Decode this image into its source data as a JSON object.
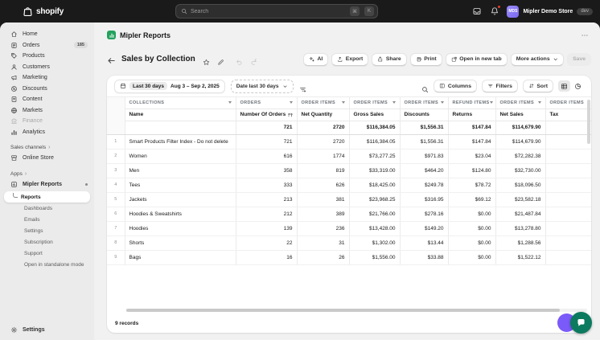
{
  "topbar": {
    "logo": "shopify",
    "search_placeholder": "Search",
    "key_1": "⌘",
    "key_2": "K",
    "store_name": "Mipler Demo Store",
    "store_env": "dev",
    "avatar_initials": "MDS"
  },
  "sidebar": {
    "items": [
      {
        "label": "Home",
        "icon": "home"
      },
      {
        "label": "Orders",
        "icon": "orders",
        "badge": "185"
      },
      {
        "label": "Products",
        "icon": "products"
      },
      {
        "label": "Customers",
        "icon": "customers"
      },
      {
        "label": "Marketing",
        "icon": "marketing"
      },
      {
        "label": "Discounts",
        "icon": "discounts"
      },
      {
        "label": "Content",
        "icon": "content"
      },
      {
        "label": "Markets",
        "icon": "markets"
      },
      {
        "label": "Finance",
        "icon": "finance",
        "disabled": true
      },
      {
        "label": "Analytics",
        "icon": "analytics"
      }
    ],
    "sales_channels_label": "Sales channels",
    "sales_channel_items": [
      {
        "label": "Online Store",
        "icon": "store"
      }
    ],
    "apps_label": "Apps",
    "app": {
      "label": "Mipler Reports",
      "icon": "app"
    },
    "app_items": [
      {
        "label": "Reports",
        "selected": true
      },
      {
        "label": "Dashboards"
      },
      {
        "label": "Emails"
      },
      {
        "label": "Settings"
      },
      {
        "label": "Subscription"
      },
      {
        "label": "Support"
      },
      {
        "label": "Open in standalone mode"
      }
    ],
    "settings_label": "Settings"
  },
  "header": {
    "app_title": "Mipler Reports",
    "page_title": "Sales by Collection"
  },
  "actions": {
    "ai": "AI",
    "export": "Export",
    "share": "Share",
    "print": "Print",
    "open_new_tab": "Open in new tab",
    "more": "More actions",
    "save": "Save"
  },
  "toolbar": {
    "range_chip": "Last 30 days",
    "range_text": "Aug 3 – Sep 2, 2025",
    "date_filter": "Date last 30 days",
    "columns": "Columns",
    "filters": "Filters",
    "sort": "Sort"
  },
  "table": {
    "group_headers": [
      "COLLECTIONS",
      "ORDERS",
      "ORDER ITEMS",
      "ORDER ITEMS",
      "ORDER ITEMS",
      "REFUND ITEMS",
      "ORDER ITEMS",
      "ORDER ITEMS"
    ],
    "columns": [
      "Name",
      "Number Of Orders",
      "Net Quantity",
      "Gross Sales",
      "Discounts",
      "Returns",
      "Net Sales",
      "Tax"
    ],
    "sorted_column": "Number Of Orders",
    "totals": [
      "",
      "721",
      "2720",
      "$116,384.05",
      "$1,556.31",
      "$147.84",
      "$114,679.90",
      ""
    ],
    "rows": [
      [
        "Smart Products Filter Index - Do not delete",
        "721",
        "2720",
        "$116,384.05",
        "$1,556.31",
        "$147.84",
        "$114,679.90",
        ""
      ],
      [
        "Women",
        "616",
        "1774",
        "$73,277.25",
        "$971.83",
        "$23.04",
        "$72,282.38",
        ""
      ],
      [
        "Men",
        "358",
        "819",
        "$33,319.00",
        "$464.20",
        "$124.80",
        "$32,730.00",
        ""
      ],
      [
        "Tees",
        "333",
        "626",
        "$18,425.00",
        "$249.78",
        "$78.72",
        "$18,096.50",
        ""
      ],
      [
        "Jackets",
        "213",
        "381",
        "$23,968.25",
        "$316.95",
        "$69.12",
        "$23,582.18",
        ""
      ],
      [
        "Hoodies & Sweatshirts",
        "212",
        "389",
        "$21,766.00",
        "$278.16",
        "$0.00",
        "$21,487.84",
        ""
      ],
      [
        "Hoodies",
        "139",
        "236",
        "$13,428.00",
        "$149.20",
        "$0.00",
        "$13,278.80",
        ""
      ],
      [
        "Shorts",
        "22",
        "31",
        "$1,302.00",
        "$13.44",
        "$0.00",
        "$1,288.56",
        ""
      ],
      [
        "Bags",
        "16",
        "26",
        "$1,556.00",
        "$33.88",
        "$0.00",
        "$1,522.12",
        ""
      ]
    ]
  },
  "footer": {
    "records": "9 records"
  },
  "colors": {
    "topbar_bg": "#1a1a1a",
    "sidebar_bg": "#ebebeb",
    "main_bg": "#f1f1f1",
    "accent_green": "#23a15d",
    "avatar_purple": "#8a7ff0",
    "notification_red": "#e53d2e",
    "chat_green": "#0c7a5e",
    "chat_purple": "#7a5af8"
  }
}
